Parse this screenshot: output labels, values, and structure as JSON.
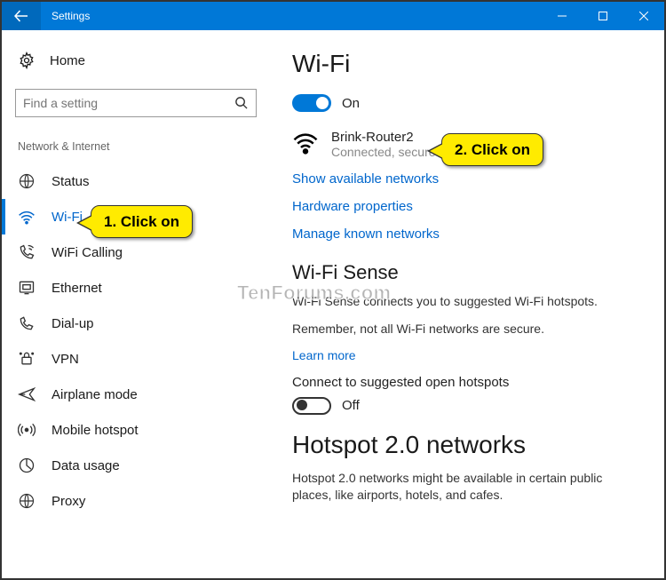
{
  "titlebar": {
    "title": "Settings"
  },
  "sidebar": {
    "home": "Home",
    "search_placeholder": "Find a setting",
    "category": "Network & Internet",
    "items": [
      {
        "label": "Status"
      },
      {
        "label": "Wi-Fi"
      },
      {
        "label": "WiFi Calling"
      },
      {
        "label": "Ethernet"
      },
      {
        "label": "Dial-up"
      },
      {
        "label": "VPN"
      },
      {
        "label": "Airplane mode"
      },
      {
        "label": "Mobile hotspot"
      },
      {
        "label": "Data usage"
      },
      {
        "label": "Proxy"
      }
    ]
  },
  "main": {
    "page_title": "Wi-Fi",
    "wifi_toggle_label": "On",
    "network": {
      "name": "Brink-Router2",
      "status": "Connected, secured"
    },
    "link_show": "Show available networks",
    "link_hw": "Hardware properties",
    "link_manage": "Manage known networks",
    "sense_heading": "Wi-Fi Sense",
    "sense_desc": "Wi-Fi Sense connects you to suggested Wi-Fi hotspots.",
    "sense_note": "Remember, not all Wi-Fi networks are secure.",
    "sense_learn": "Learn more",
    "sense_toggle_title": "Connect to suggested open hotspots",
    "sense_toggle_label": "Off",
    "hotspot_heading": "Hotspot 2.0 networks",
    "hotspot_desc": "Hotspot 2.0 networks might be available in certain public places, like airports, hotels, and cafes."
  },
  "callouts": {
    "c1": "1. Click on",
    "c2": "2. Click on"
  },
  "watermark": "TenForums.com"
}
